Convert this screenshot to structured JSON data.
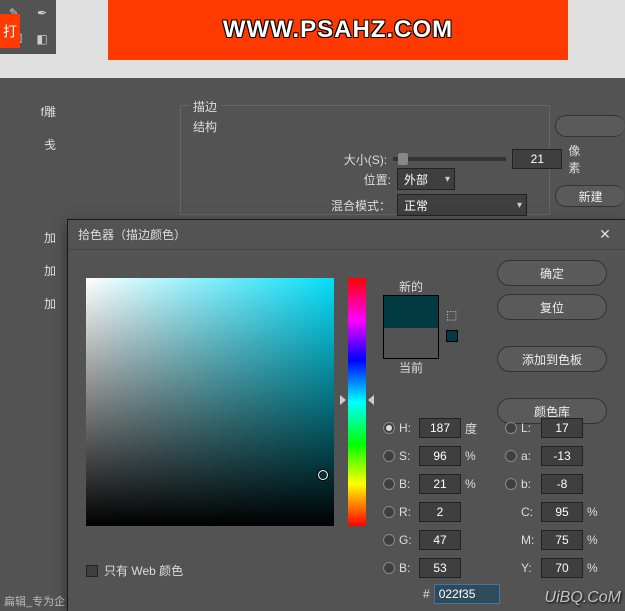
{
  "banner": {
    "url": "WWW.PSAHZ.COM"
  },
  "toolstrip": {
    "redlabel": "打"
  },
  "leftpanel": {
    "item1": "f雕",
    "item2": "戋",
    "item3": "加",
    "item4": "加",
    "item5": "加"
  },
  "stroke": {
    "group_title": "描边",
    "structure": "结构",
    "size_label": "大小(S):",
    "size_value": "21",
    "size_unit": "像素",
    "position_label": "位置:",
    "position_value": "外部",
    "blend_label": "混合模式：",
    "blend_value": "正常"
  },
  "rightbuttons": {
    "btn1": "",
    "btn2": "新建"
  },
  "colorpicker": {
    "title": "拾色器（描边颜色）",
    "new_label": "新的",
    "current_label": "当前",
    "ok": "确定",
    "cancel": "复位",
    "add_swatch": "添加到色板",
    "color_lib": "颜色库",
    "web_only": "只有 Web 颜色",
    "H": {
      "label": "H:",
      "value": "187",
      "unit": "度"
    },
    "S": {
      "label": "S:",
      "value": "96",
      "unit": "%"
    },
    "Bv": {
      "label": "B:",
      "value": "21",
      "unit": "%"
    },
    "R": {
      "label": "R:",
      "value": "2"
    },
    "G": {
      "label": "G:",
      "value": "47"
    },
    "Bc": {
      "label": "B:",
      "value": "53"
    },
    "L": {
      "label": "L:",
      "value": "17"
    },
    "a": {
      "label": "a:",
      "value": "-13"
    },
    "b": {
      "label": "b:",
      "value": "-8"
    },
    "C": {
      "label": "C:",
      "value": "95",
      "unit": "%"
    },
    "M": {
      "label": "M:",
      "value": "75",
      "unit": "%"
    },
    "Y": {
      "label": "Y:",
      "value": "70",
      "unit": "%"
    },
    "hex_label": "#",
    "hex_value": "022f35"
  },
  "watermark": "UiBQ.CoM",
  "footer": "扁辑_专为企"
}
